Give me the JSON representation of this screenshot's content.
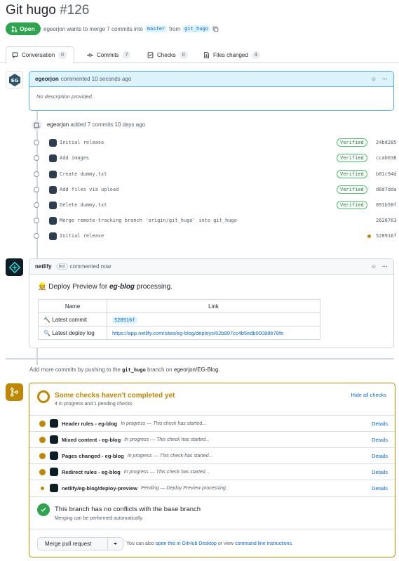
{
  "pr": {
    "title": "Git hugo",
    "number": "#126",
    "state": "Open",
    "meta_prefix": "egeorjon wants to merge 7 commits into",
    "base_branch": "master",
    "from_word": "from",
    "head_branch": "git_hugo"
  },
  "tabs": [
    {
      "label": "Conversation",
      "count": "0"
    },
    {
      "label": "Commits",
      "count": "7"
    },
    {
      "label": "Checks",
      "count": "0"
    },
    {
      "label": "Files changed",
      "count": "4"
    }
  ],
  "comment1": {
    "author": "egeorjon",
    "action": "commented 10 seconds ago",
    "body": "No description provided."
  },
  "commits_event": {
    "author": "egeorjon",
    "action": "added 7 commits 10 days ago"
  },
  "commits": [
    {
      "message": "Initial release",
      "verified": "Verified",
      "sha": "24bd285"
    },
    {
      "message": "Add images",
      "verified": "Verified",
      "sha": "ccab038"
    },
    {
      "message": "Create dummy.txt",
      "verified": "Verified",
      "sha": "b01c94d"
    },
    {
      "message": "Add files via upload",
      "verified": "Verified",
      "sha": "d6d7dda"
    },
    {
      "message": "Delete dummy.txt",
      "verified": "Verified",
      "sha": "891b58f"
    },
    {
      "message": "Merge remote-tracking branch 'origin/git_hugo' into git_hugo",
      "verified": "",
      "sha": "2628763"
    },
    {
      "message": "Initial release",
      "verified": "",
      "sha": "528916f"
    }
  ],
  "comment2": {
    "author": "netlify",
    "badge": "bot",
    "action": "commented now",
    "deploy_title_prefix": "Deploy Preview for",
    "deploy_site": "eg-blog",
    "deploy_title_suffix": "processing.",
    "col_name": "Name",
    "col_link": "Link",
    "row1_name": "Latest commit",
    "row1_link": "528916f",
    "row2_name": "Latest deploy log",
    "row2_link": "https://app.netlify.com/sites/eg-blog/deploys/62b997cc4b5edb00088b78fe"
  },
  "push_hint": {
    "prefix": "Add more commits by pushing to the",
    "branch": "git_hugo",
    "middle": "branch on",
    "repo": "egeorjon/EG-Blog",
    "suffix": "."
  },
  "checks": {
    "title": "Some checks haven't completed yet",
    "subtitle": "4 in progress and 1 pending checks",
    "hide_label": "Hide all checks",
    "items": [
      {
        "name": "Header rules - eg-blog",
        "status": "In progress — This check has started...",
        "details": "Details"
      },
      {
        "name": "Mixed content - eg-blog",
        "status": "In progress — This check has started...",
        "details": "Details"
      },
      {
        "name": "Pages changed - eg-blog",
        "status": "In progress — This check has started...",
        "details": "Details"
      },
      {
        "name": "Redirect rules - eg-blog",
        "status": "In progress — This check has started...",
        "details": "Details"
      },
      {
        "name": "netlify/eg-blog/deploy-preview",
        "status": "Pending — Deploy Preview processing.",
        "details": "Details"
      }
    ]
  },
  "conflicts": {
    "title": "This branch has no conflicts with the base branch",
    "subtitle": "Merging can be performed automatically."
  },
  "merge": {
    "button": "Merge pull request",
    "hint_prefix": "You can also",
    "hint_link1": "open this in GitHub Desktop",
    "hint_middle": "or view",
    "hint_link2": "command line instructions",
    "hint_suffix": "."
  },
  "colors": {
    "open_green": "#2da44e",
    "pending_amber": "#bf8700",
    "link_blue": "#0969da",
    "success_green": "#1a7f37"
  }
}
